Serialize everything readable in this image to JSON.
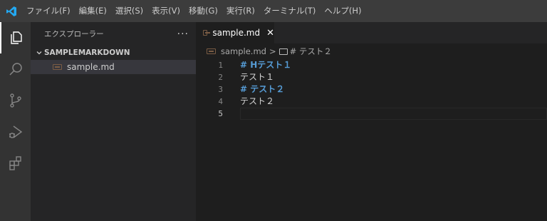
{
  "menubar": {
    "items": [
      "ファイル(F)",
      "編集(E)",
      "選択(S)",
      "表示(V)",
      "移動(G)",
      "実行(R)",
      "ターミナル(T)",
      "ヘルプ(H)"
    ]
  },
  "activitybar": {
    "icons": [
      "explorer-icon",
      "search-icon",
      "source-control-icon",
      "run-debug-icon",
      "extensions-icon"
    ]
  },
  "sidebar": {
    "title": "エクスプローラー",
    "more": "···",
    "folder": "SAMPLEMARKDOWN",
    "files": [
      {
        "name": "sample.md"
      }
    ]
  },
  "tabs": [
    {
      "label": "sample.md",
      "close": "✕"
    }
  ],
  "breadcrumb": {
    "file": "sample.md",
    "separator": ">",
    "symbol": "# テスト２"
  },
  "editor": {
    "lines": [
      {
        "number": "1",
        "text": "# Hテスト１",
        "kind": "heading"
      },
      {
        "number": "2",
        "text": "テスト１",
        "kind": "plain"
      },
      {
        "number": "3",
        "text": "# テスト２",
        "kind": "heading"
      },
      {
        "number": "4",
        "text": "テスト２",
        "kind": "plain"
      },
      {
        "number": "5",
        "text": "",
        "kind": "plain"
      }
    ],
    "current_line": "5"
  },
  "colors": {
    "menubar": "#3c3c3c",
    "activitybar": "#333333",
    "sidebar": "#252526",
    "editor": "#1e1e1e",
    "heading": "#569cd6",
    "accent": "#23a9f2"
  }
}
